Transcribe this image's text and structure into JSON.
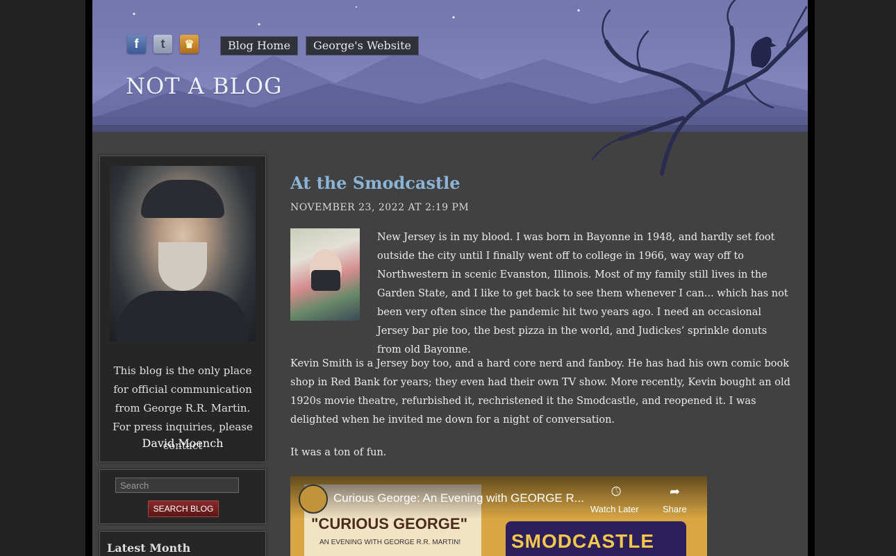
{
  "header": {
    "social": [
      {
        "name": "facebook-icon",
        "glyph": "f"
      },
      {
        "name": "twitter-icon",
        "glyph": "t"
      },
      {
        "name": "livejournal-crown-icon",
        "glyph": "♛"
      }
    ],
    "nav": [
      "Blog Home",
      "George's Website"
    ],
    "site_title": "NOT A BLOG"
  },
  "sidebar": {
    "about_text": "This blog is the only place for official communication from George R.R. Martin. For press inquiries, please contact",
    "about_link": "David Moench",
    "search_placeholder": "Search",
    "search_button": "SEARCH BLOG",
    "latest_title": "Latest Month"
  },
  "post": {
    "title": "At the Smodcastle",
    "date": "NOVEMBER 23, 2022 AT 2:19 PM",
    "paragraphs": [
      "New Jersey is in my blood.   I was born in Bayonne in 1948, and hardly set foot outside the city until I finally went off to college in 1966, way way off to Northwestern in scenic Evanston, Illinois.   Most of my family still lives in the Garden State, and I like to get back to see them whenever I can... which has not been very often since the pandemic hit two years ago.   I need an occasional Jersey bar pie too, the best pizza in the world, and Judickes’ sprinkle donuts from old Bayonne.",
      "Kevin Smith is a Jersey boy too, and a hard core nerd and fanboy.   He has had his own comic book shop in Red Bank for years; they even had their own TV show.   More recently, Kevin bought an old 1920s movie theatre, refurbished it, rechristened it the Smodcastle, and reopened it.   I was delighted when he invited me down for a night of conversation.",
      "It was a ton of fun."
    ],
    "video": {
      "title": "Curious George: An Evening with GEORGE R...",
      "watch_later": "Watch Later",
      "share": "Share",
      "poster_title": "\"CURIOUS GEORGE\"",
      "poster_sub": "AN EVENING WITH GEORGE R.R. MARTIN!",
      "sign_text": "SMODCASTLE"
    }
  }
}
